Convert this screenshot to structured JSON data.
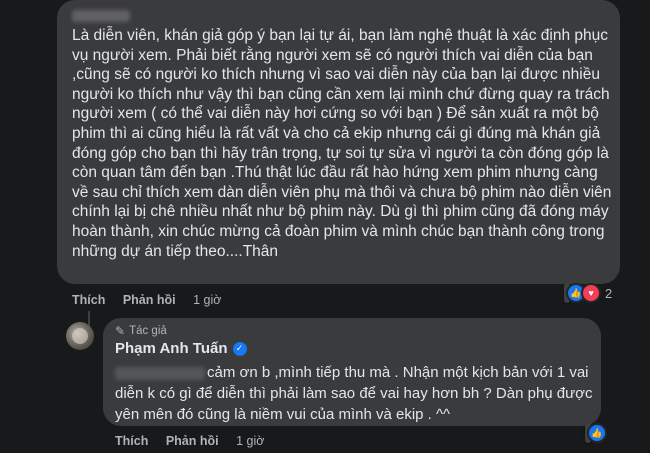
{
  "comment1": {
    "body": "Là diễn viên, khán giả góp ý bạn lại tự ái, bạn làm nghệ thuật là xác định phục vụ người xem. Phải biết rằng người xem sẽ có người thích vai diễn của bạn ,cũng sẽ có người ko thích nhưng vì sao vai diễn này của bạn lại được nhiều người ko thích như vậy thì bạn cũng cần xem lại mình chứ đừng quay ra trách người xem ( có thể vai diễn này hơi cứng so với bạn ) Để sản xuất ra một bộ phim thì ai cũng hiểu là rất vất và cho cả ekip nhưng cái gì đúng mà khán giả đóng góp cho bạn thì hãy trân trọng, tự soi tự sửa vì người ta còn đóng góp là còn quan tâm đến bạn .Thú thật lúc đầu rất hào hứng xem phim nhưng càng về sau chỉ thích xem dàn diễn viên phụ mà thôi và chưa bộ phim nào diễn viên chính lại bị chê nhiều nhất như bộ phim này. Dù gì thì phim cũng đã đóng máy hoàn thành, xin chúc mừng cả đoàn phim và mình chúc bạn thành công trong những dự án tiếp theo....Thân",
    "like_label": "Thích",
    "reply_label": "Phản hồi",
    "time": "1 giờ",
    "reaction_count": "2"
  },
  "reply": {
    "author_tag": "Tác giả",
    "author_name": "Phạm Anh Tuấn",
    "body": "cảm ơn b ,mình tiếp thu mà . Nhận một kịch bản với 1 vai diễn k có gì để diễn thì phải làm sao để vai hay hơn bh ? Dàn phụ được yên mên đó cũng là niềm vui của mình và ekip . ^^",
    "like_label": "Thích",
    "reply_label": "Phản hồi",
    "time": "1 giờ"
  },
  "colors": {
    "background": "#18191a",
    "bubble": "#3a3b3c",
    "text": "#e4e6eb",
    "muted": "#b0b3b8",
    "like": "#1877f2",
    "love": "#f33e58"
  },
  "icons": [
    "like-icon",
    "heart-icon",
    "pen-icon",
    "verified-icon"
  ]
}
